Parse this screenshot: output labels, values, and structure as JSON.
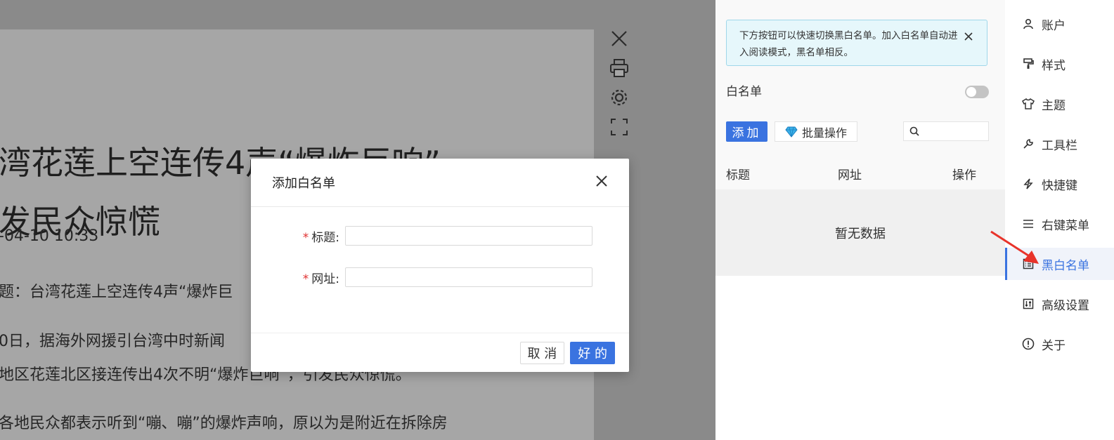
{
  "article": {
    "title": "湾花莲上空连传4声“爆炸巨响”，\n发民众惊慌",
    "date": "-04-10 10:33",
    "p1": "题：台湾花莲上空连传4声“爆炸巨",
    "p2": "0日，据海外网援引台湾中时新闻",
    "p3": "地区花莲北区接连传出4次不明“爆炸巨响”，引发民众惊慌。",
    "p4": "各地民众都表示听到“嘣、嘣”的爆炸声响，原以为是附近在拆除房"
  },
  "modal": {
    "title": "添加白名单",
    "title_label": "标题:",
    "url_label": "网址:",
    "title_value": "",
    "url_value": "",
    "cancel": "取 消",
    "ok": "好 的"
  },
  "panel": {
    "notice": "下方按钮可以快速切换黑白名单。加入白名单自动进入阅读模式，黑名单相反。",
    "whitelist_label": "白名单",
    "whitelist_enabled": false,
    "add_button": "添加",
    "batch_button": "批量操作",
    "search_placeholder": "",
    "columns": [
      "标题",
      "网址",
      "操作"
    ],
    "empty_text": "暂无数据"
  },
  "nav": {
    "items": [
      {
        "label": "账户",
        "icon": "user-icon"
      },
      {
        "label": "样式",
        "icon": "paint-roller-icon"
      },
      {
        "label": "主题",
        "icon": "shirt-icon"
      },
      {
        "label": "工具栏",
        "icon": "wrench-icon"
      },
      {
        "label": "快捷键",
        "icon": "lightning-icon"
      },
      {
        "label": "右键菜单",
        "icon": "menu-lines-icon"
      },
      {
        "label": "黑白名单",
        "icon": "list-icon",
        "active": true
      },
      {
        "label": "高级设置",
        "icon": "sliders-icon"
      },
      {
        "label": "关于",
        "icon": "info-icon"
      }
    ]
  },
  "colors": {
    "accent": "#3a73e0",
    "notice_bg": "#e6f7fb",
    "annotation_arrow": "#e8332a"
  }
}
